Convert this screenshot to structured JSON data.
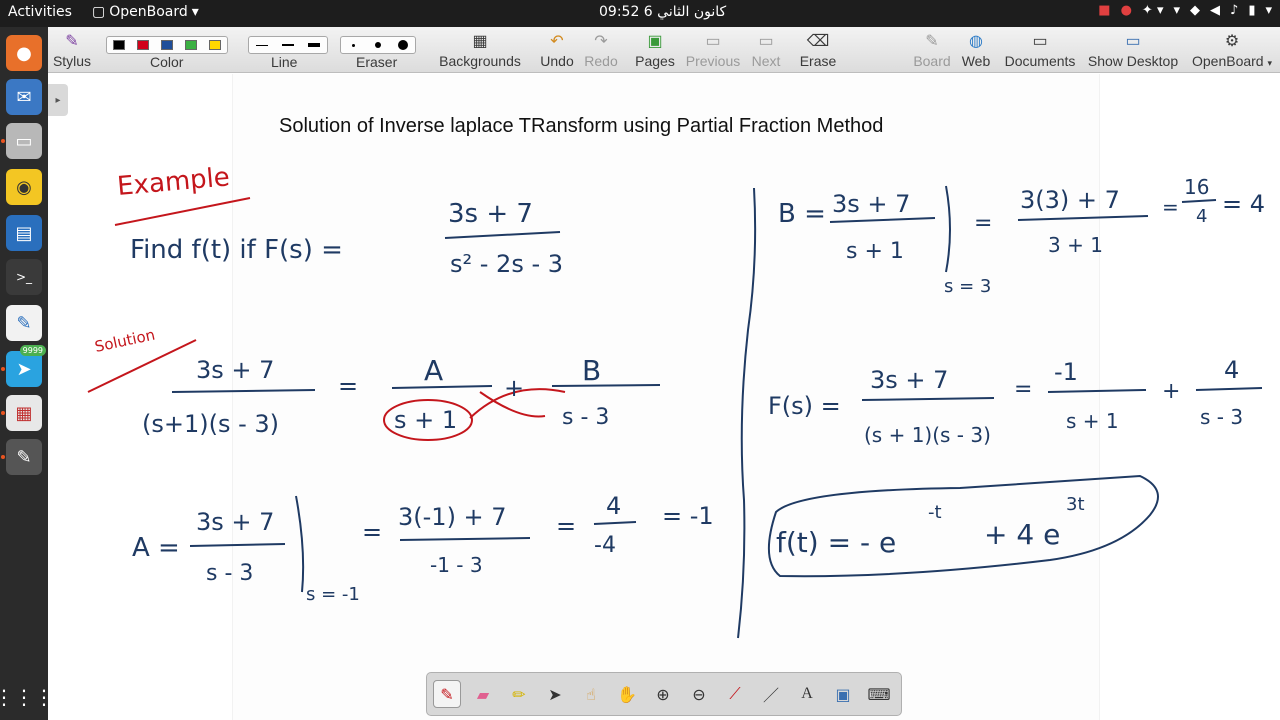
{
  "topbar": {
    "activities": "Activities",
    "app_name": "OpenBoard",
    "clock": "09:52  6 كانون الثاني"
  },
  "toolbar": {
    "stylus": "Stylus",
    "color": "Color",
    "line": "Line",
    "eraser": "Eraser",
    "backgrounds": "Backgrounds",
    "undo": "Undo",
    "redo": "Redo",
    "pages": "Pages",
    "previous": "Previous",
    "next": "Next",
    "erase": "Erase",
    "board": "Board",
    "web": "Web",
    "documents": "Documents",
    "show_desktop": "Show Desktop",
    "openboard": "OpenBoard"
  },
  "colors": {
    "swatches": [
      "#000000",
      "#d0021b",
      "#1f4e99",
      "#3cb043",
      "#ffd700"
    ],
    "ink_blue": "#1f3a63",
    "ink_red": "#c4161c"
  },
  "dock": {
    "telegram_badge": "9999"
  },
  "board": {
    "title": "Solution of Inverse laplace TRansform using Partial Fraction Method",
    "ink": {
      "example": "Example",
      "find": "Find f(t) if F(s) =",
      "f_num": "3s + 7",
      "f_den": "s² - 2s - 3",
      "solution": "Solution",
      "lhs_num": "3s + 7",
      "lhs_den": "(s+1)(s - 3)",
      "eq1": "=",
      "a_num": "A",
      "a_den": "s + 1",
      "plus1": "+",
      "b_num": "B",
      "b_den": "s - 3",
      "A_lhs": "A =",
      "A_num": "3s + 7",
      "A_den": "s - 3",
      "A_eval": "s = -1",
      "A_eq": "=",
      "A_num2": "3(-1) + 7",
      "A_den2": "-1 - 3",
      "A_eq2": "=",
      "A_num3": "4",
      "A_den3": "-4",
      "A_res": "= -1",
      "B_lhs": "B =",
      "B_num": "3s + 7",
      "B_den": "s + 1",
      "B_eval": "s = 3",
      "B_eq": "=",
      "B_num2": "3(3) + 7",
      "B_den2": "3 + 1",
      "B_res": "=",
      "B_num3": "16",
      "B_den3": "4",
      "B_final": "= 4",
      "F_lhs": "F(s) =",
      "F_num": "3s + 7",
      "F_den": "(s + 1)(s - 3)",
      "F_eq": "=",
      "F_n1": "-1",
      "F_d1": "s + 1",
      "F_plus": "+",
      "F_n2": "4",
      "F_d2": "s - 3",
      "result": "f(t) = - e",
      "result_exp1": "-t",
      "result_mid": "+ 4 e",
      "result_exp2": "3t"
    }
  }
}
